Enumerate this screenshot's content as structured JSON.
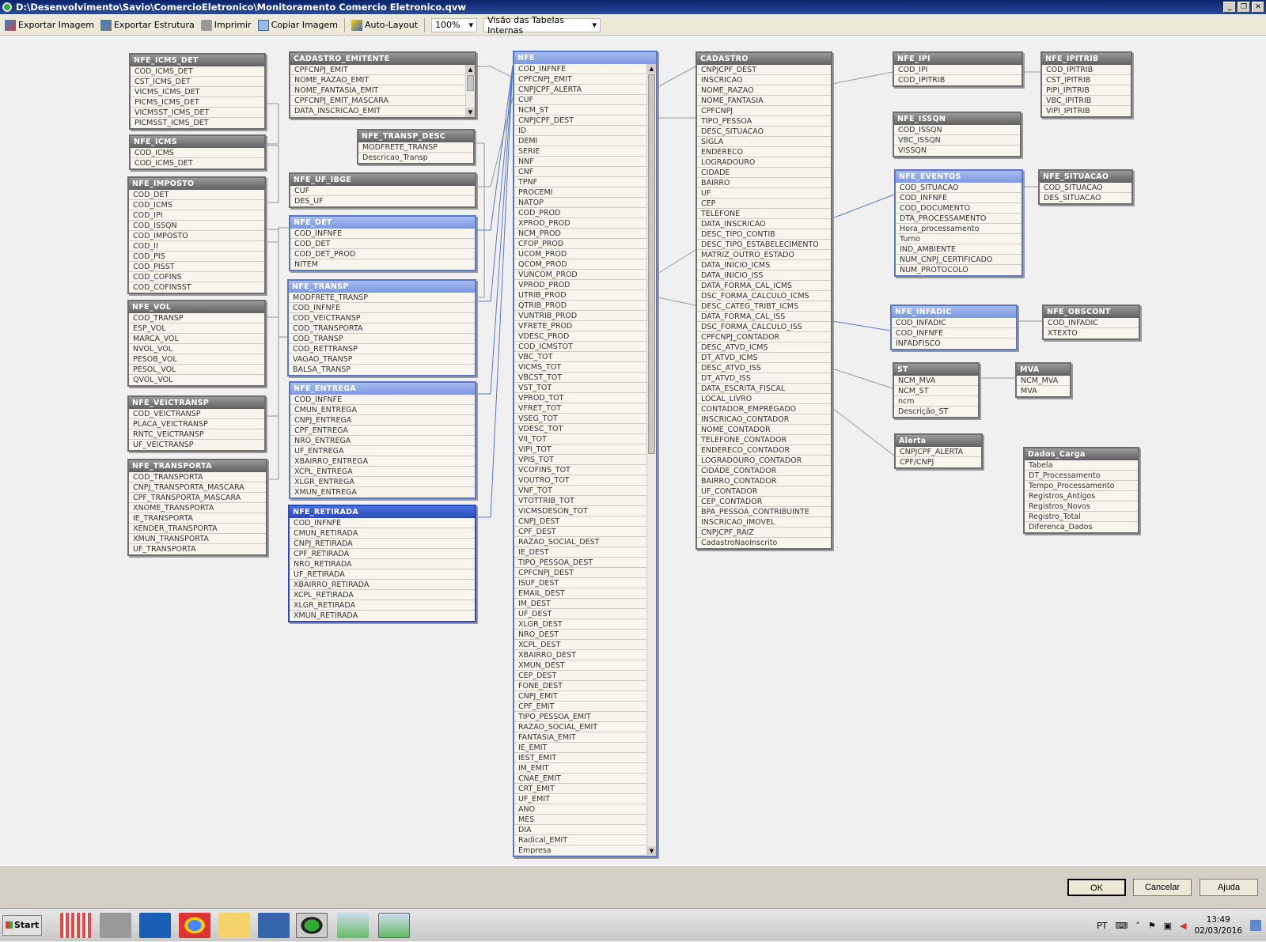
{
  "window": {
    "title": "D:\\Desenvolvimento\\Savio\\ComercioEletronico\\Monitoramento Comercio Eletronico.qvw",
    "buttons": [
      "_",
      "❐",
      "✕"
    ]
  },
  "toolbar": {
    "export_image": "Exportar Imagem",
    "export_structure": "Exportar Estrutura",
    "print": "Imprimir",
    "copy_image": "Copiar Imagem",
    "auto_layout": "Auto-Layout",
    "zoom": "100%",
    "view": "Visão das Tabelas Internas"
  },
  "tables": [
    {
      "name": "NFE_ICMS_DET",
      "fields": [
        "COD_ICMS_DET",
        "CST_ICMS_DET",
        "VICMS_ICMS_DET",
        "PICMS_ICMS_DET",
        "VICMSST_ICMS_DET",
        "PICMSST_ICMS_DET"
      ]
    },
    {
      "name": "CADASTRO_EMITENTE",
      "fields": [
        "CPFCNPJ_EMIT",
        "NOME_RAZAO_EMIT",
        "NOME_FANTASIA_EMIT",
        "CPFCNPJ_EMIT_MASCARA",
        "DATA_INSCRICAO_EMIT"
      ]
    },
    {
      "name": "NFE",
      "fields": [
        "COD_INFNFE",
        "CPFCNPJ_EMIT",
        "CNPJCPF_ALERTA",
        "CUF",
        "NCM_ST",
        "CNPJCPF_DEST",
        "ID",
        "DEMI",
        "SERIE",
        "NNF",
        "CNF",
        "TPNF",
        "PROCEMI",
        "NATOP",
        "COD_PROD",
        "XPROD_PROD",
        "NCM_PROD",
        "CFOP_PROD",
        "UCOM_PROD",
        "QCOM_PROD",
        "VUNCOM_PROD",
        "VPROD_PROD",
        "UTRIB_PROD",
        "QTRIB_PROD",
        "VUNTRIB_PROD",
        "VFRETE_PROD",
        "VDESC_PROD",
        "COD_ICMSTOT",
        "VBC_TOT",
        "VICMS_TOT",
        "VBCST_TOT",
        "VST_TOT",
        "VPROD_TOT",
        "VFRET_TOT",
        "VSEG_TOT",
        "VDESC_TOT",
        "VII_TOT",
        "VIPI_TOT",
        "VPIS_TOT",
        "VCOFINS_TOT",
        "VOUTRO_TOT",
        "VNF_TOT",
        "VTOTTRIB_TOT",
        "VICMSDESON_TOT",
        "CNPJ_DEST",
        "CPF_DEST",
        "RAZAO_SOCIAL_DEST",
        "IE_DEST",
        "TIPO_PESSOA_DEST",
        "CPFCNPJ_DEST",
        "ISUF_DEST",
        "EMAIL_DEST",
        "IM_DEST",
        "UF_DEST",
        "XLGR_DEST",
        "NRO_DEST",
        "XCPL_DEST",
        "XBAIRRO_DEST",
        "XMUN_DEST",
        "CEP_DEST",
        "FONE_DEST",
        "CNPJ_EMIT",
        "CPF_EMIT",
        "TIPO_PESSOA_EMIT",
        "RAZAO_SOCIAL_EMIT",
        "FANTASIA_EMIT",
        "IE_EMIT",
        "IEST_EMIT",
        "IM_EMIT",
        "CNAE_EMIT",
        "CRT_EMIT",
        "UF_EMIT",
        "ANO",
        "MES",
        "DIA",
        "Radical_EMIT",
        "Empresa"
      ]
    },
    {
      "name": "CADASTRO",
      "fields": [
        "CNPJCPF_DEST",
        "INSCRICAO",
        "NOME_RAZAO",
        "NOME_FANTASIA",
        "CPFCNPJ",
        "TIPO_PESSOA",
        "DESC_SITUACAO",
        "SIGLA",
        "ENDERECO",
        "LOGRADOURO",
        "CIDADE",
        "BAIRRO",
        "UF",
        "CEP",
        "TELEFONE",
        "DATA_INSCRICAO",
        "DESC_TIPO_CONTIB",
        "DESC_TIPO_ESTABELECIMENTO",
        "MATRIZ_OUTRO_ESTADO",
        "DATA_INICIO_ICMS",
        "DATA_INICIO_ISS",
        "DATA_FORMA_CAL_ICMS",
        "DSC_FORMA_CALCULO_ICMS",
        "DESC_CATEG_TRIBT_ICMS",
        "DATA_FORMA_CAL_ISS",
        "DSC_FORMA_CALCULO_ISS",
        "CPFCNPJ_CONTADOR",
        "DESC_ATVD_ICMS",
        "DT_ATVD_ICMS",
        "DESC_ATVD_ISS",
        "DT_ATVD_ISS",
        "DATA_ESCRITA_FISCAL",
        "LOCAL_LIVRO",
        "CONTADOR_EMPREGADO",
        "INSCRICAO_CONTADOR",
        "NOME_CONTADOR",
        "TELEFONE_CONTADOR",
        "ENDERECO_CONTADOR",
        "LOGRADOURO_CONTADOR",
        "CIDADE_CONTADOR",
        "BAIRRO_CONTADOR",
        "UF_CONTADOR",
        "CEP_CONTADOR",
        "BPA_PESSOA_CONTRIBUINTE",
        "INSCRICAO_IMOVEL",
        "CNPJCPF_RAIZ",
        "CadastroNaoInscrito"
      ]
    },
    {
      "name": "NFE_IPI",
      "fields": [
        "COD_IPI",
        "COD_IPITRIB"
      ]
    },
    {
      "name": "NFE_IPITRIB",
      "fields": [
        "COD_IPITRIB",
        "CST_IPITRIB",
        "PIPI_IPITRIB",
        "VBC_IPITRIB",
        "VIPI_IPITRIB"
      ]
    },
    {
      "name": "NFE_ISSQN",
      "fields": [
        "COD_ISSQN",
        "VBC_ISSQN",
        "VISSQN"
      ]
    },
    {
      "name": "NFE_EVENTOS",
      "fields": [
        "COD_SITUACAO",
        "COD_INFNFE",
        "COD_DOCUMENTO",
        "DTA_PROCESSAMENTO",
        "Hora_processamento",
        "Turno",
        "IND_AMBIENTE",
        "NUM_CNPJ_CERTIFICADO",
        "NUM_PROTOCOLO"
      ]
    },
    {
      "name": "NFE_SITUACAO",
      "fields": [
        "COD_SITUACAO",
        "DES_SITUACAO"
      ]
    },
    {
      "name": "NFE_INFADIC",
      "fields": [
        "COD_INFADIC",
        "COD_INFNFE",
        "INFADFISCO"
      ]
    },
    {
      "name": "NFE_OBSCONT",
      "fields": [
        "COD_INFADIC",
        "XTEXTO"
      ]
    },
    {
      "name": "ST",
      "fields": [
        "NCM_MVA",
        "NCM_ST",
        "ncm",
        "Descrição_ST"
      ]
    },
    {
      "name": "MVA",
      "fields": [
        "NCM_MVA",
        "MVA"
      ]
    },
    {
      "name": "Alerta",
      "fields": [
        "CNPJCPF_ALERTA",
        "CPF/CNPJ"
      ]
    },
    {
      "name": "Dados_Carga",
      "fields": [
        "Tabela",
        "DT_Processamento",
        "Tempo_Processamento",
        "Registros_Antigos",
        "Registros_Novos",
        "Registro_Total",
        "Diferenca_Dados"
      ]
    },
    {
      "name": "NFE_ICMS",
      "fields": [
        "COD_ICMS",
        "COD_ICMS_DET"
      ]
    },
    {
      "name": "NFE_IMPOSTO",
      "fields": [
        "COD_DET",
        "COD_ICMS",
        "COD_IPI",
        "COD_ISSQN",
        "COD_IMPOSTO",
        "COD_II",
        "COD_PIS",
        "COD_PISST",
        "COD_COFINS",
        "COD_COFINSST"
      ]
    },
    {
      "name": "NFE_VOL",
      "fields": [
        "COD_TRANSP",
        "ESP_VOL",
        "MARCA_VOL",
        "NVOL_VOL",
        "PESOB_VOL",
        "PESOL_VOL",
        "QVOL_VOL"
      ]
    },
    {
      "name": "NFE_VEICTRANSP",
      "fields": [
        "COD_VEICTRANSP",
        "PLACA_VEICTRANSP",
        "RNTC_VEICTRANSP",
        "UF_VEICTRANSP"
      ]
    },
    {
      "name": "NFE_TRANSPORTA",
      "fields": [
        "COD_TRANSPORTA",
        "CNPJ_TRANSPORTA_MASCARA",
        "CPF_TRANSPORTA_MASCARA",
        "XNOME_TRANSPORTA",
        "IE_TRANSPORTA",
        "XENDER_TRANSPORTA",
        "XMUN_TRANSPORTA",
        "UF_TRANSPORTA"
      ]
    },
    {
      "name": "NFE_TRANSP_DESC",
      "fields": [
        "MODFRETE_TRANSP",
        "Descricao_Transp"
      ]
    },
    {
      "name": "NFE_UF_IBGE",
      "fields": [
        "CUF",
        "DES_UF"
      ]
    },
    {
      "name": "NFE_DET",
      "fields": [
        "COD_INFNFE",
        "COD_DET",
        "COD_DET_PROD",
        "NITEM"
      ]
    },
    {
      "name": "NFE_TRANSP",
      "fields": [
        "MODFRETE_TRANSP",
        "COD_INFNFE",
        "COD_VEICTRANSP",
        "COD_TRANSPORTA",
        "COD_TRANSP",
        "COD_RETTRANSP",
        "VAGAO_TRANSP",
        "BALSA_TRANSP"
      ]
    },
    {
      "name": "NFE_ENTREGA",
      "fields": [
        "COD_INFNFE",
        "CMUN_ENTREGA",
        "CNPJ_ENTREGA",
        "CPF_ENTREGA",
        "NRO_ENTREGA",
        "UF_ENTREGA",
        "XBAIRRO_ENTREGA",
        "XCPL_ENTREGA",
        "XLGR_ENTREGA",
        "XMUN_ENTREGA"
      ]
    },
    {
      "name": "NFE_RETIRADA",
      "fields": [
        "COD_INFNFE",
        "CMUN_RETIRADA",
        "CNPJ_RETIRADA",
        "CPF_RETIRADA",
        "NRO_RETIRADA",
        "UF_RETIRADA",
        "XBAIRRO_RETIRADA",
        "XCPL_RETIRADA",
        "XLGR_RETIRADA",
        "XMUN_RETIRADA"
      ]
    }
  ],
  "dialog": {
    "ok": "OK",
    "cancel": "Cancelar",
    "help": "Ajuda"
  },
  "taskbar": {
    "start": "Start",
    "language": "PT",
    "time": "13:49",
    "date": "02/03/2016"
  },
  "colors": {
    "selected_header": "#2a4ab8",
    "highlight_header": "#8ea8e6",
    "header": "#707070"
  }
}
